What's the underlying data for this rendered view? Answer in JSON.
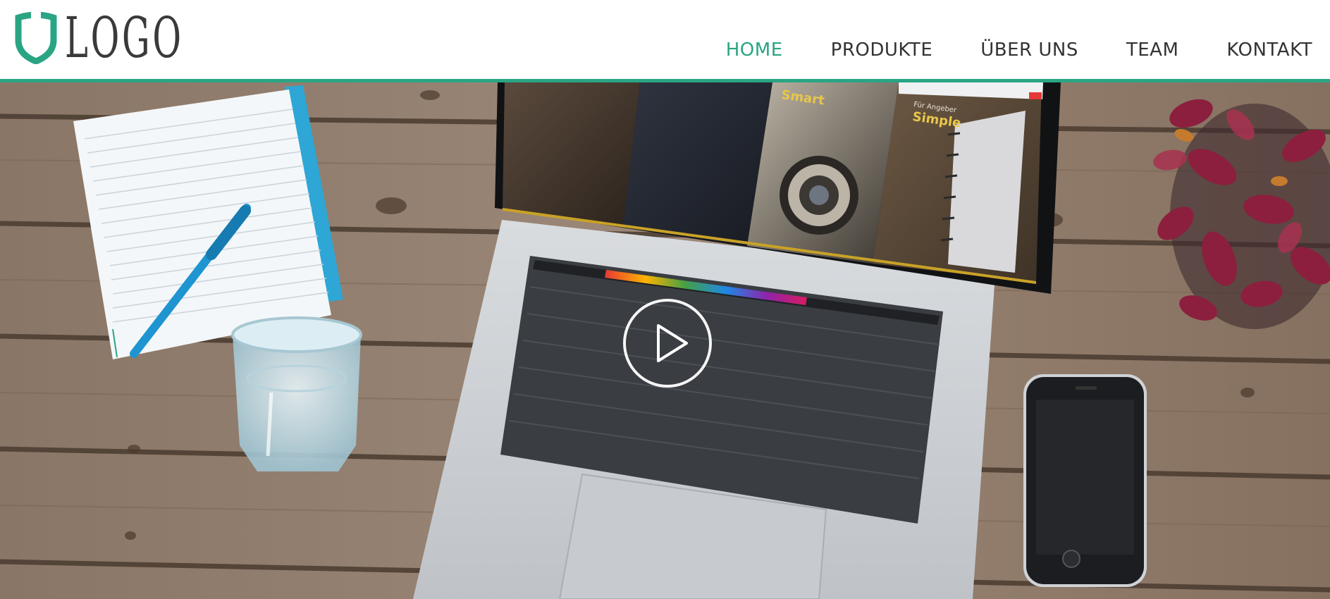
{
  "brand": {
    "logo_text": "LOGO",
    "accent_color": "#2aa584",
    "logo_icon": "shield-icon"
  },
  "nav": {
    "items": [
      {
        "label": "HOME",
        "active": true
      },
      {
        "label": "PRODUKTE",
        "active": false
      },
      {
        "label": "ÜBER UNS",
        "active": false
      },
      {
        "label": "TEAM",
        "active": false
      },
      {
        "label": "KONTAKT",
        "active": false
      }
    ]
  },
  "hero": {
    "play_icon": "play-icon",
    "screen_panels": [
      {
        "label": "Smart"
      },
      {
        "label": "Für Angeber",
        "heading": "Simple"
      }
    ]
  }
}
